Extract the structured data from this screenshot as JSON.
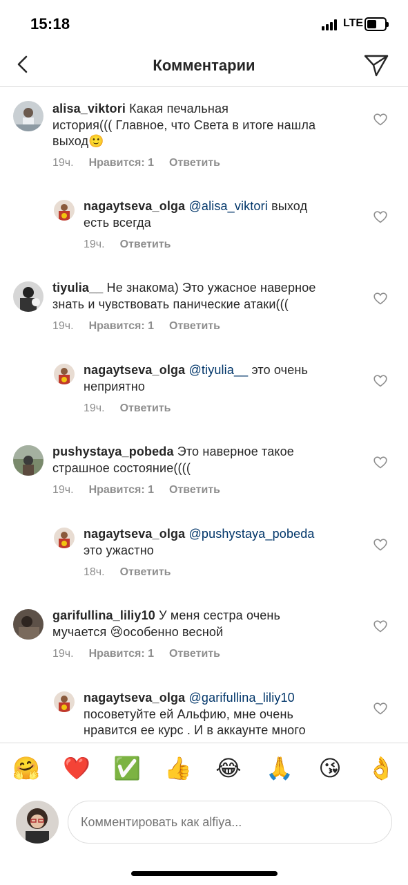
{
  "status": {
    "time": "15:18",
    "network": "LTE"
  },
  "header": {
    "title": "Комментарии",
    "back_icon": "chevron-left-icon",
    "share_icon": "paper-plane-icon"
  },
  "colors": {
    "mention": "#003569",
    "meta": "#8e8e8e",
    "text": "#262626",
    "divider": "#dbdbdb"
  },
  "comments": [
    {
      "user": "alisa_viktori",
      "text": "Какая печальная",
      "text2": "история((( Главное, что Света в итоге нашла",
      "text3": "выход🙂",
      "time": "19ч.",
      "likes": "Нравится: 1",
      "reply": "Ответить"
    },
    {
      "user": "nagaytseva_olga",
      "mention": "@alisa_viktori",
      "text": "выход",
      "text2": "есть всегда",
      "time": "19ч.",
      "reply": "Ответить"
    },
    {
      "user": "tiyulia__",
      "text": "Не знакома) Это ужасное наверное",
      "text2": "знать и чувствовать панические атаки(((",
      "time": "19ч.",
      "likes": "Нравится: 1",
      "reply": "Ответить"
    },
    {
      "user": "nagaytseva_olga",
      "mention": "@tiyulia__",
      "text": "это очень",
      "text2": "неприятно",
      "time": "19ч.",
      "reply": "Ответить"
    },
    {
      "user": "pushystaya_pobeda",
      "text": "Это наверное такое",
      "text2": "страшное состояние((((",
      "time": "19ч.",
      "likes": "Нравится: 1",
      "reply": "Ответить"
    },
    {
      "user": "nagaytseva_olga",
      "mention": "@pushystaya_pobeda",
      "text2": "это ужастно",
      "time": "18ч.",
      "reply": "Ответить"
    },
    {
      "user": "garifullina_liliy10",
      "text": "У меня сестра очень",
      "text2": "мучается 😢особенно весной",
      "time": "19ч.",
      "likes": "Нравится: 1",
      "reply": "Ответить"
    },
    {
      "user": "nagaytseva_olga",
      "mention": "@garifullina_liliy10",
      "text2": "посоветуйте ей Альфию, мне очень",
      "text3": "нравится ее курс . И в аккаунте много"
    }
  ],
  "emoji_bar": [
    "🤗",
    "❤️",
    "✅",
    "👍",
    "😂",
    "🙏",
    "😘",
    "👌"
  ],
  "composer": {
    "placeholder": "Комментировать как alfiya..."
  }
}
